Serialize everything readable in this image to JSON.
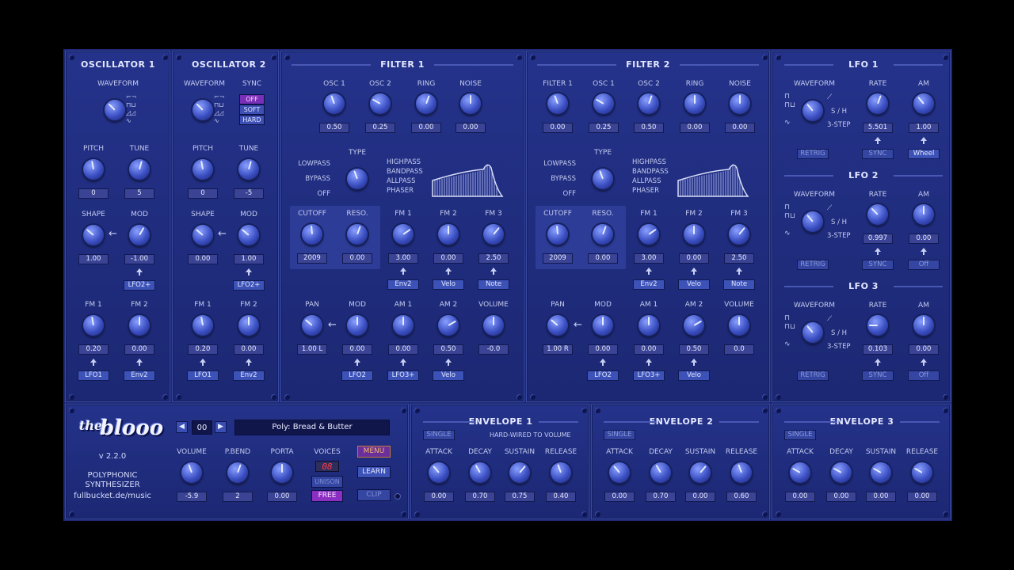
{
  "osc1": {
    "title": "OSCILLATOR 1",
    "waveform": "WAVEFORM",
    "pitch": {
      "label": "PITCH",
      "value": "0"
    },
    "tune": {
      "label": "TUNE",
      "value": "5"
    },
    "shape": {
      "label": "SHAPE",
      "value": "1.00"
    },
    "mod": {
      "label": "MOD",
      "value": "-1.00",
      "src": "LFO2+"
    },
    "fm1": {
      "label": "FM 1",
      "value": "0.20",
      "src": "LFO1"
    },
    "fm2": {
      "label": "FM 2",
      "value": "0.00",
      "src": "Env2"
    }
  },
  "osc2": {
    "title": "OSCILLATOR 2",
    "waveform": "WAVEFORM",
    "sync": "SYNC",
    "sync_opts": [
      "OFF",
      "SOFT",
      "HARD"
    ],
    "pitch": {
      "label": "PITCH",
      "value": "0"
    },
    "tune": {
      "label": "TUNE",
      "value": "-5"
    },
    "shape": {
      "label": "SHAPE",
      "value": "0.00"
    },
    "mod": {
      "label": "MOD",
      "value": "1.00",
      "src": "LFO2+"
    },
    "fm1": {
      "label": "FM 1",
      "value": "0.20",
      "src": "LFO1"
    },
    "fm2": {
      "label": "FM 2",
      "value": "0.00",
      "src": "Env2"
    }
  },
  "filter1": {
    "title": "FILTER 1",
    "src_labels": [
      "OSC 1",
      "OSC 2",
      "RING",
      "NOISE"
    ],
    "src_values": [
      "0.50",
      "0.25",
      "0.00",
      "0.00"
    ],
    "type": "TYPE",
    "types_left": [
      "LOWPASS",
      "BYPASS",
      "OFF"
    ],
    "types_right": [
      "HIGHPASS",
      "BANDPASS",
      "ALLPASS",
      "PHASER"
    ],
    "cutoff": {
      "label": "CUTOFF",
      "value": "2009"
    },
    "reso": {
      "label": "RESO.",
      "value": "0.00"
    },
    "fm": [
      {
        "label": "FM 1",
        "value": "3.00",
        "src": "Env2"
      },
      {
        "label": "FM 2",
        "value": "0.00",
        "src": "Velo"
      },
      {
        "label": "FM 3",
        "value": "2.50",
        "src": "Note"
      }
    ],
    "pan": {
      "label": "PAN",
      "value": "1.00 L"
    },
    "mod": {
      "label": "MOD",
      "value": "0.00",
      "src": "LFO2"
    },
    "am": [
      {
        "label": "AM 1",
        "value": "0.00",
        "src": "LFO3+"
      },
      {
        "label": "AM 2",
        "value": "0.50",
        "src": "Velo"
      }
    ],
    "volume": {
      "label": "VOLUME",
      "value": "-0.0"
    }
  },
  "filter2": {
    "title": "FILTER 2",
    "src_labels": [
      "FILTER 1",
      "OSC 1",
      "OSC 2",
      "RING",
      "NOISE"
    ],
    "src_values": [
      "0.00",
      "0.25",
      "0.50",
      "0.00",
      "0.00"
    ],
    "type": "TYPE",
    "types_left": [
      "LOWPASS",
      "BYPASS",
      "OFF"
    ],
    "types_right": [
      "HIGHPASS",
      "BANDPASS",
      "ALLPASS",
      "PHASER"
    ],
    "cutoff": {
      "label": "CUTOFF",
      "value": "2009"
    },
    "reso": {
      "label": "RESO.",
      "value": "0.00"
    },
    "fm": [
      {
        "label": "FM 1",
        "value": "3.00",
        "src": "Env2"
      },
      {
        "label": "FM 2",
        "value": "0.00",
        "src": "Velo"
      },
      {
        "label": "FM 3",
        "value": "2.50",
        "src": "Note"
      }
    ],
    "pan": {
      "label": "PAN",
      "value": "1.00 R"
    },
    "mod": {
      "label": "MOD",
      "value": "0.00",
      "src": "LFO2"
    },
    "am": [
      {
        "label": "AM 1",
        "value": "0.00",
        "src": "LFO3+"
      },
      {
        "label": "AM 2",
        "value": "0.50",
        "src": "Velo"
      }
    ],
    "volume": {
      "label": "VOLUME",
      "value": "0.0"
    }
  },
  "lfos": [
    {
      "title": "LFO 1",
      "waveform": "WAVEFORM",
      "sh": "S / H",
      "step": "3-STEP",
      "rate": {
        "label": "RATE",
        "value": "5.501"
      },
      "am": {
        "label": "AM",
        "value": "1.00"
      },
      "retrig": "RETRIG",
      "sync": "SYNC",
      "am_src": "Wheel"
    },
    {
      "title": "LFO 2",
      "waveform": "WAVEFORM",
      "sh": "S / H",
      "step": "3-STEP",
      "rate": {
        "label": "RATE",
        "value": "0.997"
      },
      "am": {
        "label": "AM",
        "value": "0.00"
      },
      "retrig": "RETRIG",
      "sync": "SYNC",
      "am_src": "Off"
    },
    {
      "title": "LFO 3",
      "waveform": "WAVEFORM",
      "sh": "S / H",
      "step": "3-STEP",
      "rate": {
        "label": "RATE",
        "value": "0.103"
      },
      "am": {
        "label": "AM",
        "value": "0.00"
      },
      "retrig": "RETRIG",
      "sync": "SYNC",
      "am_src": "Off"
    }
  ],
  "main": {
    "logo_the": "the",
    "logo_name": "blooo",
    "version": "v 2.2.0",
    "desc1": "POLYPHONIC",
    "desc2": "SYNTHESIZER",
    "url": "fullbucket.de/music",
    "prog_num": "00",
    "prog_name": "Poly: Bread & Butter",
    "prev": "◀",
    "next": "▶",
    "volume": {
      "label": "VOLUME",
      "value": "-5.9"
    },
    "pbend": {
      "label": "P.BEND",
      "value": "2"
    },
    "porta": {
      "label": "PORTA",
      "value": "0.00"
    },
    "voices_label": "VOICES",
    "voices": "08",
    "unison": "UNISON",
    "free": "FREE",
    "menu": "MENU",
    "learn": "LEARN",
    "clip": "CLIP"
  },
  "envs": [
    {
      "title": "ENVELOPE 1",
      "single": "SINGLE",
      "note": "HARD-WIRED TO VOLUME",
      "attack": {
        "label": "ATTACK",
        "value": "0.00"
      },
      "decay": {
        "label": "DECAY",
        "value": "0.70"
      },
      "sustain": {
        "label": "SUSTAIN",
        "value": "0.75"
      },
      "release": {
        "label": "RELEASE",
        "value": "0.40"
      }
    },
    {
      "title": "ENVELOPE 2",
      "single": "SINGLE",
      "note": "",
      "attack": {
        "label": "ATTACK",
        "value": "0.00"
      },
      "decay": {
        "label": "DECAY",
        "value": "0.70"
      },
      "sustain": {
        "label": "SUSTAIN",
        "value": "0.00"
      },
      "release": {
        "label": "RELEASE",
        "value": "0.60"
      }
    },
    {
      "title": "ENVELOPE 3",
      "single": "SINGLE",
      "note": "",
      "attack": {
        "label": "ATTACK",
        "value": "0.00"
      },
      "decay": {
        "label": "DECAY",
        "value": "0.00"
      },
      "sustain": {
        "label": "SUSTAIN",
        "value": "0.00"
      },
      "release": {
        "label": "RELEASE",
        "value": "0.00"
      }
    }
  ]
}
